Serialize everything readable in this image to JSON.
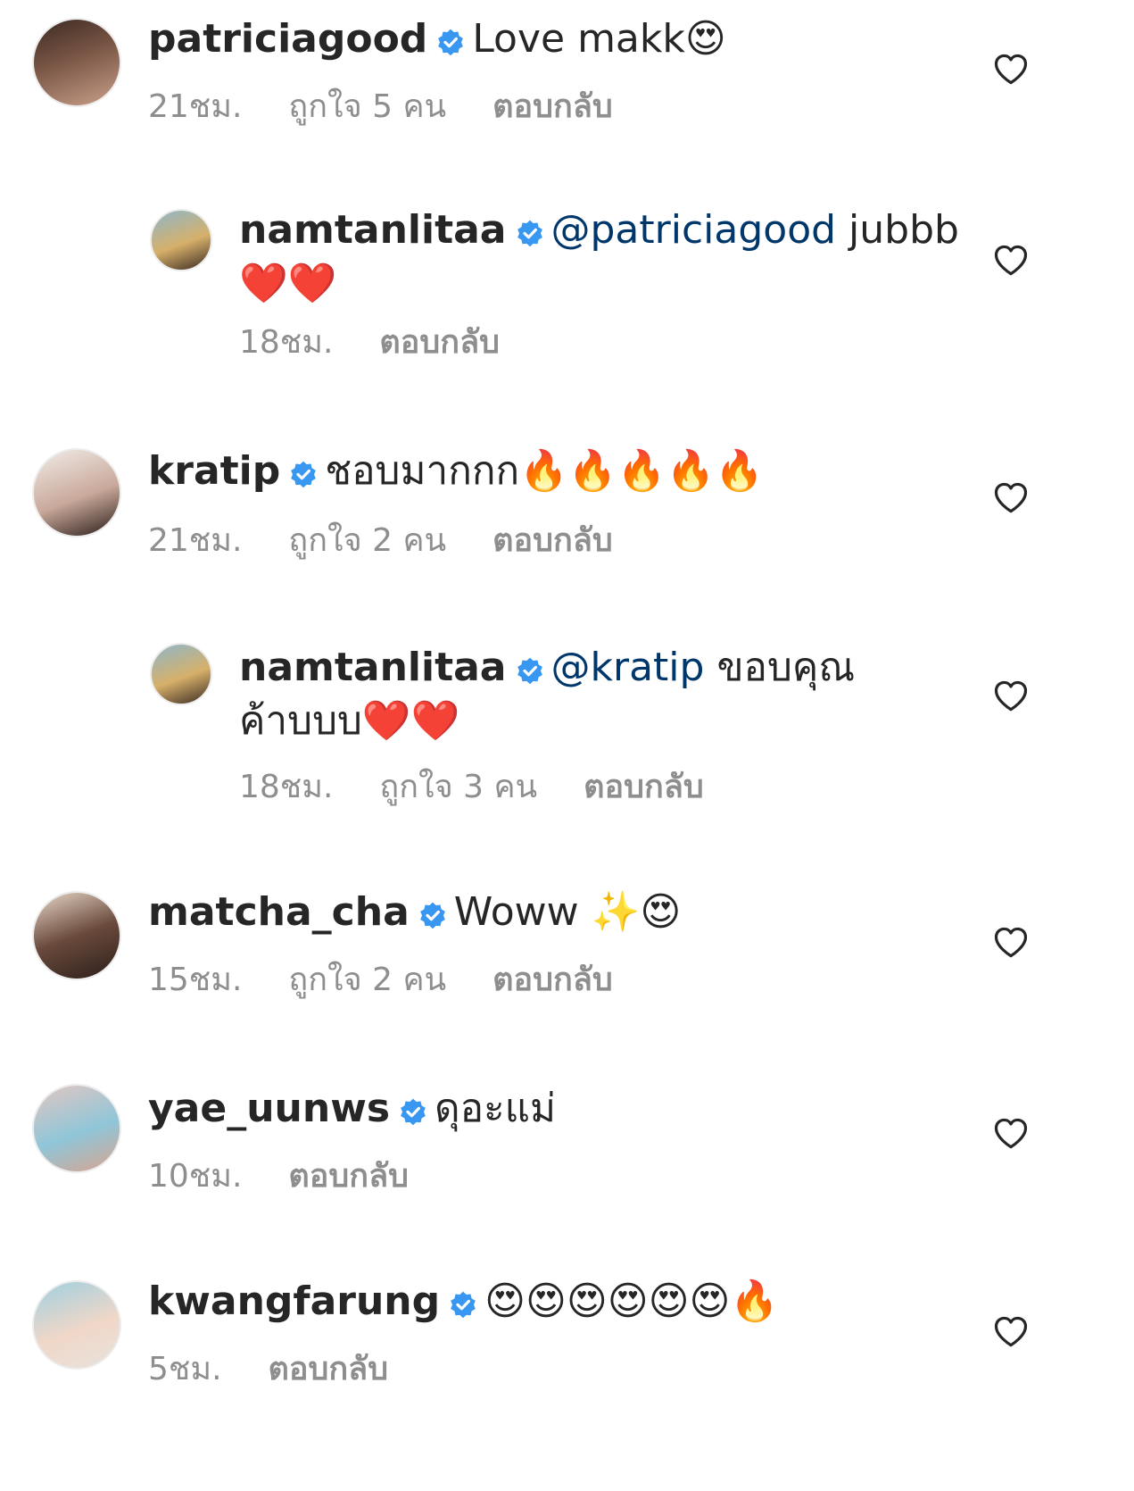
{
  "comments": [
    {
      "user": "patriciagood",
      "text": "Love makk😍",
      "time": "21ชม.",
      "likes": "ถูกใจ 5 คน",
      "reply": "ตอบกลับ"
    },
    {
      "user": "namtanlitaa",
      "mention": "@patriciagood",
      "text": "jubbb ❤️❤️",
      "time": "18ชม.",
      "reply": "ตอบกลับ"
    },
    {
      "user": "kratip",
      "text": "ชอบมากกก🔥🔥🔥🔥🔥",
      "time": "21ชม.",
      "likes": "ถูกใจ 2 คน",
      "reply": "ตอบกลับ"
    },
    {
      "user": "namtanlitaa",
      "mention": "@kratip",
      "text": "ขอบคุณค้าบบบ❤️❤️",
      "time": "18ชม.",
      "likes": "ถูกใจ 3 คน",
      "reply": "ตอบกลับ"
    },
    {
      "user": "matcha_cha",
      "text": "Woww ✨😍",
      "time": "15ชม.",
      "likes": "ถูกใจ 2 คน",
      "reply": "ตอบกลับ"
    },
    {
      "user": "yae_uunws",
      "text": "ดุอะแม่",
      "time": "10ชม.",
      "reply": "ตอบกลับ"
    },
    {
      "user": "kwangfarung",
      "text": "😍😍😍😍😍😍🔥",
      "time": "5ชม.",
      "reply": "ตอบกลับ"
    }
  ],
  "colors": {
    "verified": "#3897f0",
    "mention": "#00376b",
    "meta": "#8e8e8e"
  },
  "icons": {
    "verified": "verified-badge-icon",
    "like": "heart-outline-icon"
  }
}
